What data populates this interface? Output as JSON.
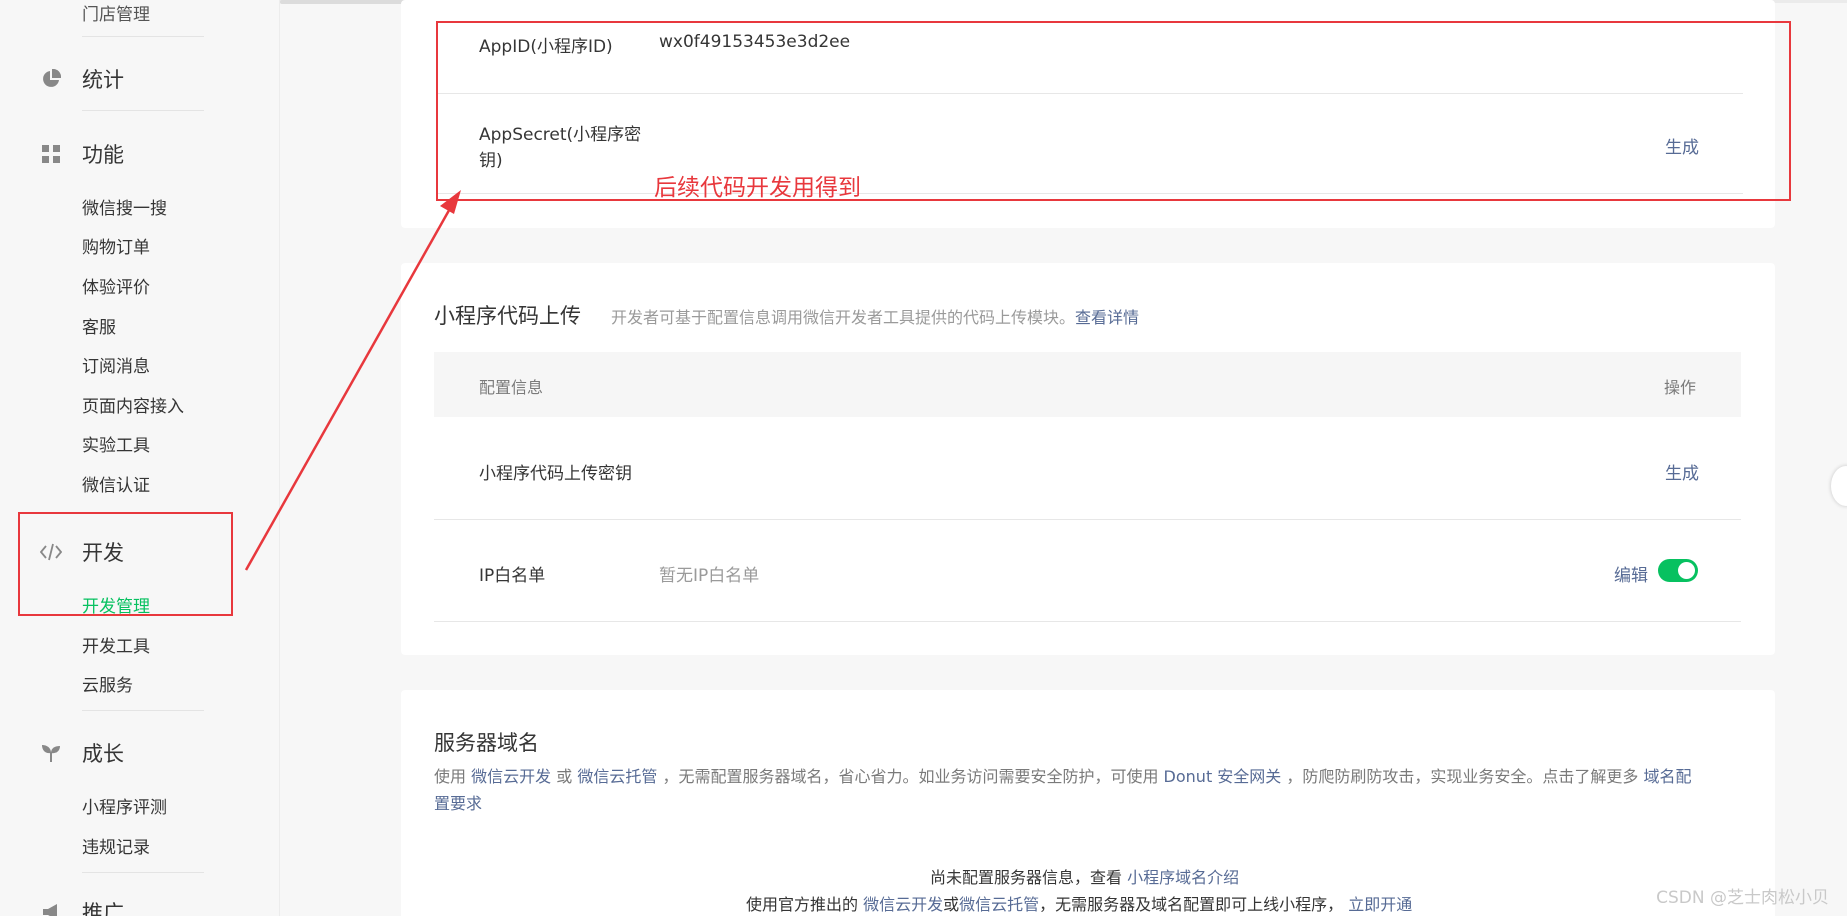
{
  "sidebar": {
    "top_cut_item": "门店管理",
    "stats": "统计",
    "features": {
      "label": "功能",
      "items": [
        "微信搜一搜",
        "购物订单",
        "体验评价",
        "客服",
        "订阅消息",
        "页面内容接入",
        "实验工具",
        "微信认证"
      ]
    },
    "develop": {
      "label": "开发",
      "items": [
        "开发管理",
        "开发工具",
        "云服务"
      ]
    },
    "growth": {
      "label": "成长",
      "items": [
        "小程序评测",
        "违规记录"
      ]
    },
    "promote": "推广"
  },
  "appinfo": {
    "appid_label": "AppID(小程序ID)",
    "appid_value": "wx0f49153453e3d2ee",
    "secret_label_line1": "AppSecret(小程序密",
    "secret_label_line2": "钥)",
    "secret_action": "生成"
  },
  "annotation": "后续代码开发用得到",
  "upload": {
    "title": "小程序代码上传",
    "desc": "开发者可基于配置信息调用微信开发者工具提供的代码上传模块。",
    "detail_link": "查看详情",
    "table_header": {
      "config": "配置信息",
      "action": "操作"
    },
    "rows": [
      {
        "label": "小程序代码上传密钥",
        "action": "生成"
      },
      {
        "label": "IP白名单",
        "value": "暂无IP白名单",
        "action": "编辑",
        "toggle_on": true
      }
    ]
  },
  "server": {
    "title": "服务器域名",
    "desc_parts": [
      "使用",
      "微信云开发",
      "或",
      "微信云托管",
      "，无需配置服务器域名，省心省力。如业务访问需要安全防护，可使用",
      "Donut 安全网关",
      "，防爬防刷防攻击，实现业务安全。点击了解更多",
      "域名配"
    ],
    "desc_line2": "置要求",
    "empty_line1_text": "尚未配置服务器信息，查看",
    "empty_line1_link": "小程序域名介绍",
    "empty_line2_parts": [
      "使用官方推出的",
      "微信云开发",
      "或",
      "微信云托管",
      "，无需服务器及域名配置即可上线小程序，",
      "立即开通"
    ]
  },
  "watermark": "CSDN @芝士肉松小贝",
  "colors": {
    "accent_green": "#07c160",
    "link_blue": "#576b95",
    "annotation_red": "#e8383d"
  }
}
